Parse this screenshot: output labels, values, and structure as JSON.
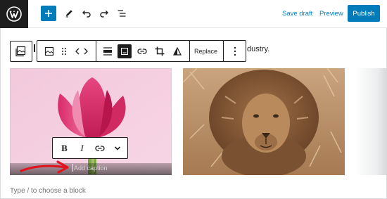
{
  "header": {
    "logo_icon": "wordpress-logo-icon",
    "add_block_icon": "plus-icon",
    "tools_icon": "pencil-icon",
    "undo_icon": "undo-icon",
    "redo_icon": "redo-icon",
    "list_view_icon": "list-view-icon",
    "save_draft_label": "Save draft",
    "preview_label": "Preview",
    "publish_label": "Publish"
  },
  "block_toolbar": {
    "parent_icon": "gallery-parent-icon",
    "items": [
      {
        "name": "image-block-icon"
      },
      {
        "name": "drag-handle-icon"
      },
      {
        "name": "move-arrows-icon"
      },
      {
        "name": "align-icon"
      },
      {
        "name": "full-width-icon"
      },
      {
        "name": "link-icon"
      },
      {
        "name": "crop-icon"
      },
      {
        "name": "filter-icon"
      }
    ],
    "replace_label": "Replace",
    "more_icon": "more-options-icon"
  },
  "paragraph_text": "dustry.",
  "gallery": {
    "images": [
      {
        "subject": "pink-tulip"
      },
      {
        "subject": "lion"
      }
    ],
    "caption_placeholder": "Add caption"
  },
  "format_toolbar": {
    "bold_label": "B",
    "italic_label": "I",
    "link_icon": "link-icon",
    "more_icon": "chevron-down-icon"
  },
  "block_placeholder": "Type / to choose a block",
  "colors": {
    "accent": "#007cba",
    "dark": "#1e1e1e",
    "annotation_red": "#e0141e"
  }
}
